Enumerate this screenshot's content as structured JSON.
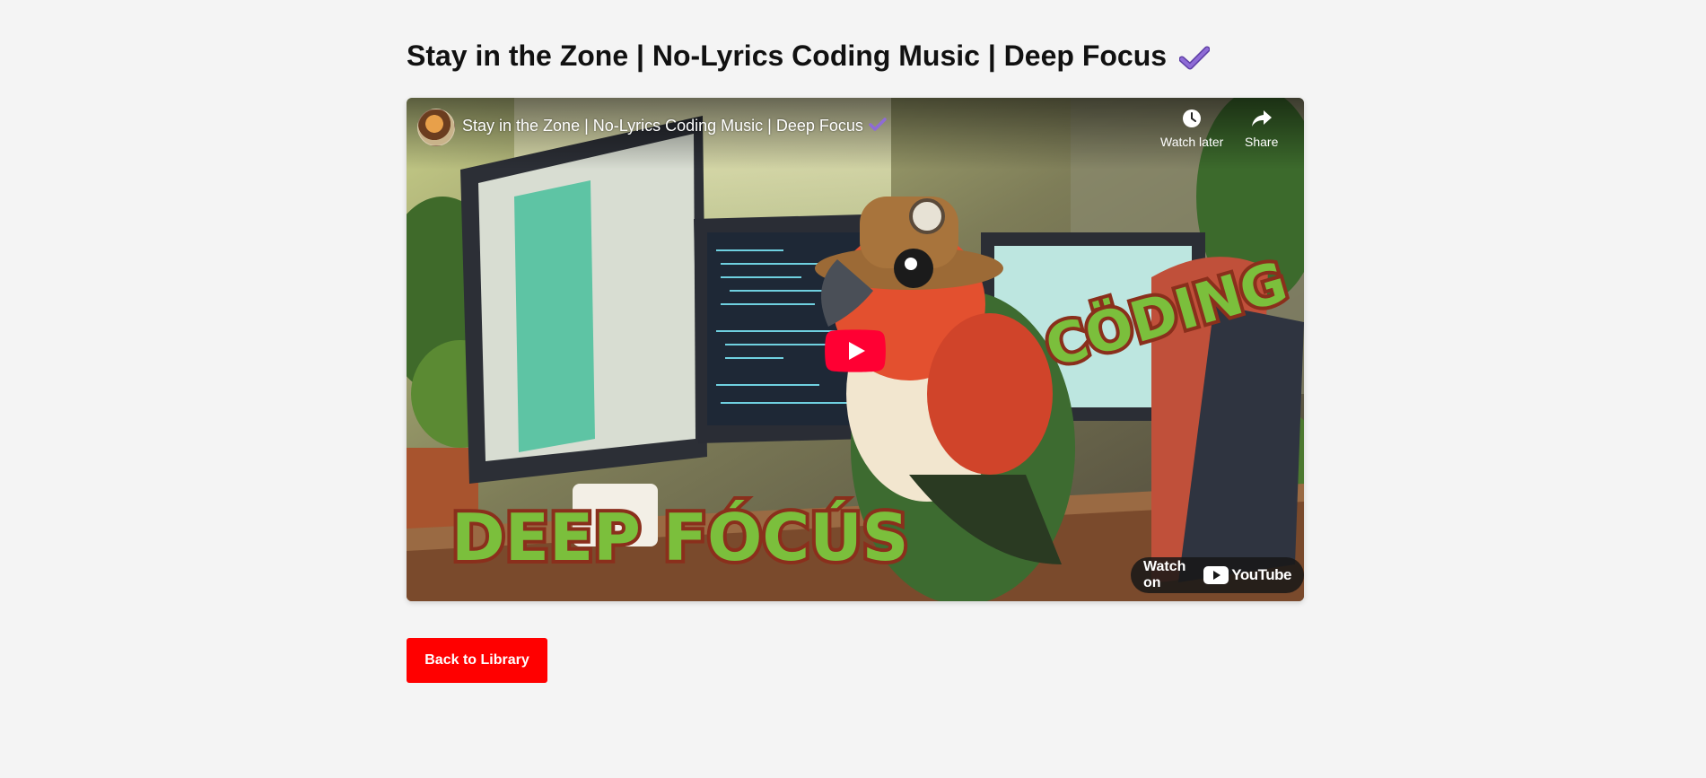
{
  "page": {
    "title": "Stay in the Zone | No-Lyrics Coding Music | Deep Focus",
    "title_badge_icon": "checkmark-icon",
    "accent_color": "#7e57c2"
  },
  "video": {
    "title": "Stay in the Zone | No-Lyrics Coding Music | Deep Focus",
    "watch_later_label": "Watch later",
    "share_label": "Share",
    "watch_on_label": "Watch on",
    "brand_label": "YouTube",
    "thumbnail_text_1": "DEEP FÓCÚS",
    "thumbnail_text_2": "CÖDING",
    "play_color": "#ff0033"
  },
  "actions": {
    "back_label": "Back to Library",
    "back_color": "#ff0000"
  }
}
